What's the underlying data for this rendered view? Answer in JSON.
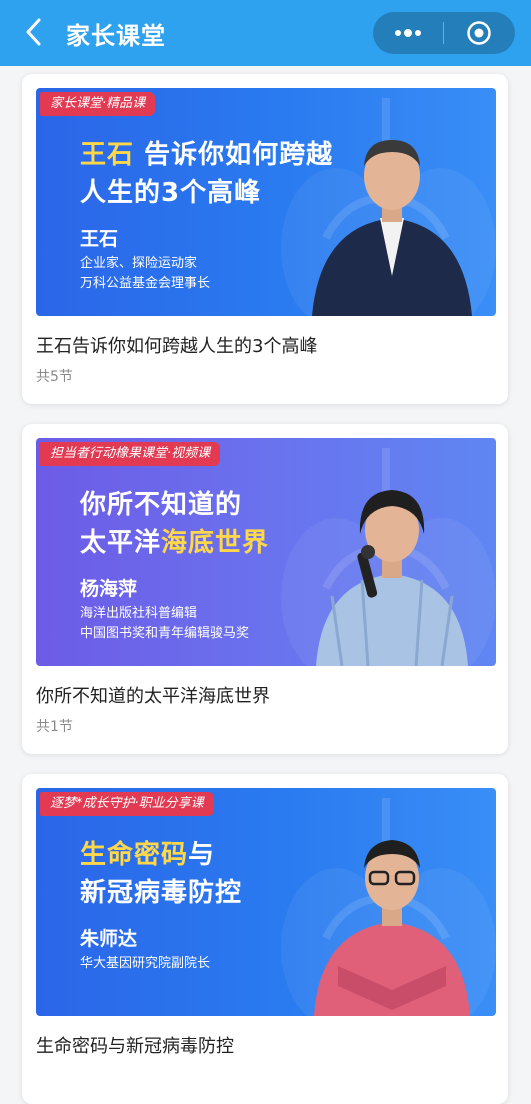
{
  "header": {
    "title": "家长课堂",
    "back_icon": "chevron-left-icon",
    "more_icon": "more-dots-icon",
    "close_icon": "target-close-icon",
    "background": "#2fa2ef"
  },
  "courses": [
    {
      "tag": "家长课堂·精品课",
      "headline_accent": "王石",
      "headline_line1_rest": " 告诉你如何跨越",
      "headline_line2": "人生的3个高峰",
      "speaker": "王石",
      "desc_line1": "企业家、探险运动家",
      "desc_line2": "万科公益基金会理事长",
      "title": "王石告诉你如何跨越人生的3个高峰",
      "count": "共5节"
    },
    {
      "tag": "担当者行动橡果课堂·视频课",
      "headline_line1": "你所不知道的",
      "headline_line2_prefix": "太平洋",
      "headline_line2_accent": "海底世界",
      "speaker": "杨海萍",
      "desc_line1": "海洋出版社科普编辑",
      "desc_line2": "中国图书奖和青年编辑骏马奖",
      "title": "你所不知道的太平洋海底世界",
      "count": "共1节"
    },
    {
      "tag": "逐梦*成长守护·职业分享课",
      "headline_line1_accent": "生命密码",
      "headline_line1_rest": "与",
      "headline_line2": "新冠病毒防控",
      "speaker": "朱师达",
      "desc_line1": "华大基因研究院副院长",
      "title": "生命密码与新冠病毒防控"
    }
  ]
}
